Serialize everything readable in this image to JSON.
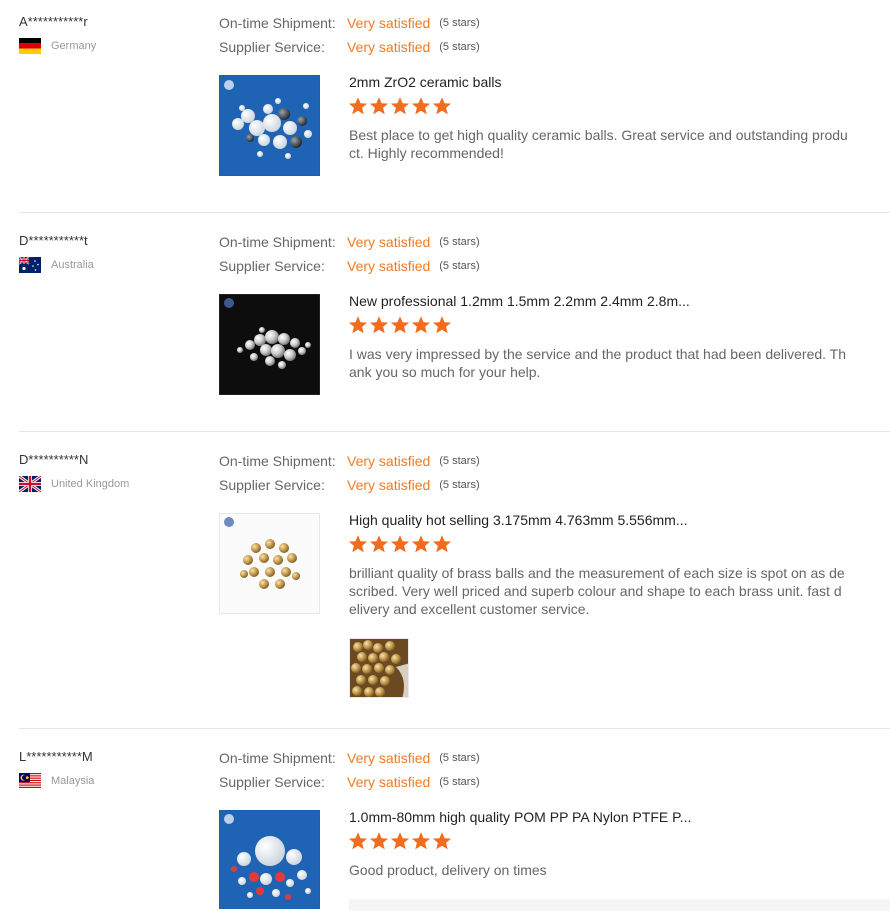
{
  "ratings_labels": {
    "shipment": "On-time Shipment:",
    "service": "Supplier Service:"
  },
  "colors": {
    "accent": "#f47a20",
    "star": "#f26c1f",
    "divider": "#e5e5e5"
  },
  "reviews": [
    {
      "buyer": "A***********r",
      "country": "Germany",
      "flag_icon": "germany-flag-icon",
      "shipment_rating": "Very satisfied",
      "shipment_stars": "(5 stars)",
      "service_rating": "Very satisfied",
      "service_stars": "(5 stars)",
      "product_title": "2mm ZrO2 ceramic balls",
      "product_image_icon": "ceramic-balls-blue-background",
      "stars": 5,
      "comment": "Best place to get high quality ceramic balls. Great service and outstanding product. Highly recommended!"
    },
    {
      "buyer": "D***********t",
      "country": "Australia",
      "flag_icon": "australia-flag-icon",
      "shipment_rating": "Very satisfied",
      "shipment_stars": "(5 stars)",
      "service_rating": "Very satisfied",
      "service_stars": "(5 stars)",
      "product_title": "New professional 1.2mm 1.5mm 2.2mm 2.4mm 2.8m...",
      "product_image_icon": "steel-balls-black-background",
      "stars": 5,
      "comment": "I was very impressed by the service and the product that had been delivered. Thank you so much for your help."
    },
    {
      "buyer": "D**********N",
      "country": "United Kingdom",
      "flag_icon": "uk-flag-icon",
      "shipment_rating": "Very satisfied",
      "shipment_stars": "(5 stars)",
      "service_rating": "Very satisfied",
      "service_stars": "(5 stars)",
      "product_title": "High quality hot selling 3.175mm 4.763mm 5.556mm...",
      "product_image_icon": "brass-balls-white-background",
      "stars": 5,
      "comment": "brilliant quality of brass balls and the measurement of each size is spot on as described. Very well priced and superb colour and shape to each brass unit. fast delivery and excellent customer service.",
      "buyer_photo_icon": "brass-balls-buyer-photo"
    },
    {
      "buyer": "L***********M",
      "country": "Malaysia",
      "flag_icon": "malaysia-flag-icon",
      "shipment_rating": "Very satisfied",
      "shipment_stars": "(5 stars)",
      "service_rating": "Very satisfied",
      "service_stars": "(5 stars)",
      "product_title": "1.0mm-80mm high quality POM PP PA Nylon PTFE P...",
      "product_image_icon": "plastic-balls-blue-background",
      "stars": 5,
      "comment": "Good product, delivery on times"
    }
  ]
}
